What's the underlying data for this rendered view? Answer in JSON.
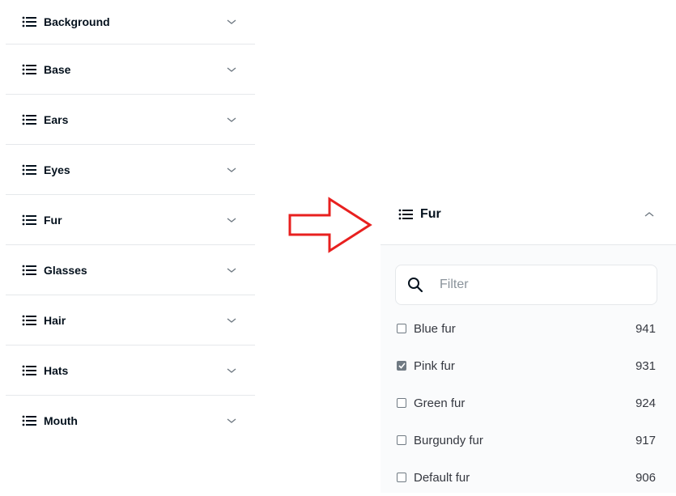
{
  "left_list": {
    "items": [
      {
        "label": "Background"
      },
      {
        "label": "Base"
      },
      {
        "label": "Ears"
      },
      {
        "label": "Eyes"
      },
      {
        "label": "Fur"
      },
      {
        "label": "Glasses"
      },
      {
        "label": "Hair"
      },
      {
        "label": "Hats"
      },
      {
        "label": "Mouth"
      }
    ],
    "icon": "list-icon",
    "expand_icon": "chevron-down-icon"
  },
  "arrow": {
    "color": "#e8201f",
    "icon": "right-arrow-icon"
  },
  "right_panel": {
    "title": "Fur",
    "collapse_icon": "chevron-up-icon",
    "filter": {
      "placeholder": "Filter",
      "value": "",
      "icon": "search-icon"
    },
    "options": [
      {
        "label": "Blue fur",
        "count": "941",
        "checked": false
      },
      {
        "label": "Pink fur",
        "count": "931",
        "checked": true
      },
      {
        "label": "Green fur",
        "count": "924",
        "checked": false
      },
      {
        "label": "Burgundy fur",
        "count": "917",
        "checked": false
      },
      {
        "label": "Default fur",
        "count": "906",
        "checked": false
      }
    ]
  }
}
